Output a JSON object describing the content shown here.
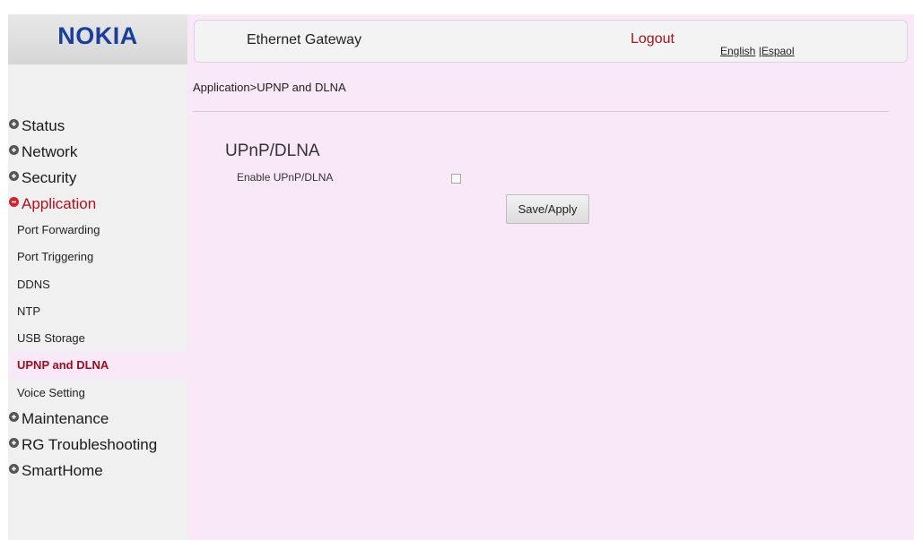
{
  "brand": {
    "logo_text": "NOKIA",
    "logo_color": "#1a3f9a"
  },
  "header": {
    "title": "Ethernet Gateway",
    "logout_label": "Logout",
    "languages": {
      "english": "English",
      "separator": " |",
      "spanish": "Espaol"
    }
  },
  "breadcrumb": "Application>UPNP and DLNA",
  "sidebar": {
    "categories": [
      {
        "label": "Status",
        "icon": "plus-circle-icon",
        "expanded": false
      },
      {
        "label": "Network",
        "icon": "plus-circle-icon",
        "expanded": false
      },
      {
        "label": "Security",
        "icon": "plus-circle-icon",
        "expanded": false
      },
      {
        "label": "Application",
        "icon": "minus-circle-icon",
        "expanded": true
      },
      {
        "label": "Maintenance",
        "icon": "plus-circle-icon",
        "expanded": false
      },
      {
        "label": "RG Troubleshooting",
        "icon": "plus-circle-icon",
        "expanded": false
      },
      {
        "label": "SmartHome",
        "icon": "plus-circle-icon",
        "expanded": false
      }
    ],
    "application_items": [
      {
        "label": "Port Forwarding",
        "selected": false
      },
      {
        "label": "Port Triggering",
        "selected": false
      },
      {
        "label": "DDNS",
        "selected": false
      },
      {
        "label": "NTP",
        "selected": false
      },
      {
        "label": "USB Storage",
        "selected": false
      },
      {
        "label": "UPNP and DLNA",
        "selected": true
      },
      {
        "label": "Voice Setting",
        "selected": false
      }
    ]
  },
  "content": {
    "section_title": "UPnP/DLNA",
    "enable_label": "Enable UPnP/DLNA",
    "enable_checked": false,
    "save_label": "Save/Apply"
  },
  "colors": {
    "content_background": "#f8e8f8",
    "sidebar_background": "#f0f0f0",
    "accent_red": "#a0161c",
    "selected_item_text": "#9b0f1c"
  }
}
